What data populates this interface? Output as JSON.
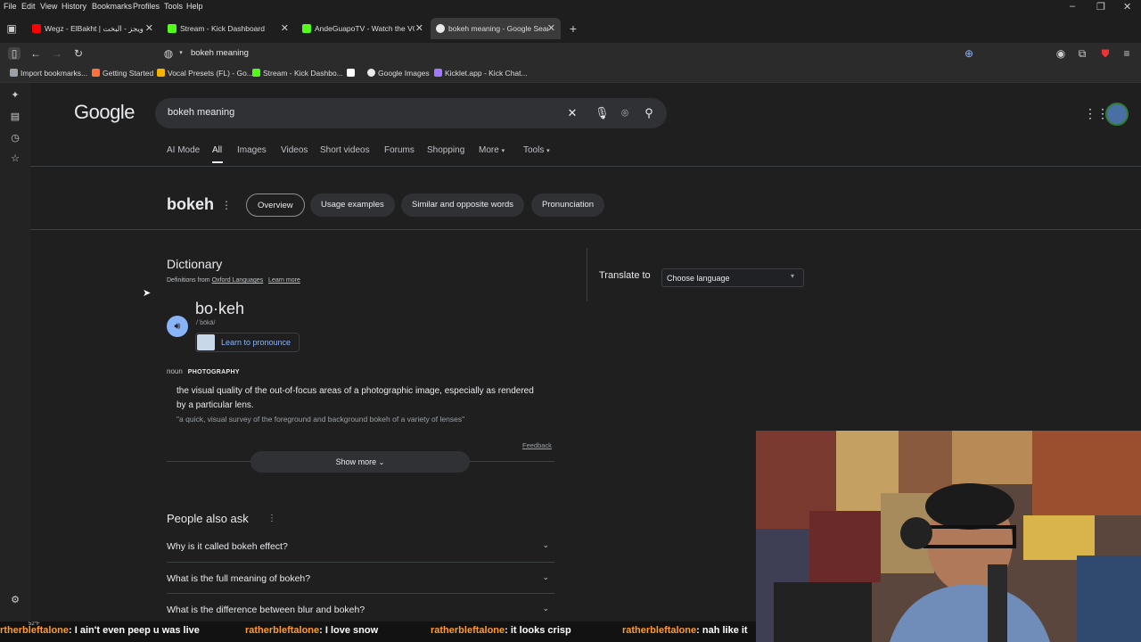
{
  "menubar": {
    "items": [
      "File",
      "Edit",
      "View",
      "History",
      "Bookmarks",
      "Profiles",
      "Tools",
      "Help"
    ]
  },
  "tabs": [
    {
      "title": "Wegz - ElBakht | ويجز - البخت",
      "favicon_color": "#ff0000"
    },
    {
      "title": "Stream - Kick Dashboard",
      "favicon_color": "#53fc18"
    },
    {
      "title": "AndeGuapoTV - Watch the VOD",
      "favicon_color": "#53fc18"
    },
    {
      "title": "bokeh meaning - Google Search",
      "favicon_color": "#e8eaed"
    }
  ],
  "address": {
    "url": "bokeh meaning"
  },
  "toolbar": {
    "extension_badge": "50"
  },
  "bookmarks": [
    {
      "label": "Import bookmarks...",
      "color": "#9aa0a6"
    },
    {
      "label": "Getting Started",
      "color": "#ff7139"
    },
    {
      "label": "Vocal Presets (FL) - Go...",
      "color": "#f4b400"
    },
    {
      "label": "Stream - Kick Dashbo...",
      "color": "#53fc18"
    },
    {
      "label": "",
      "color": "#ffffff"
    },
    {
      "label": "Google Images",
      "color": "#e8eaed"
    },
    {
      "label": "Kicklet.app - Kick Chat...",
      "color": "#a078ff"
    }
  ],
  "google": {
    "logo": "Google",
    "query": "bokeh meaning",
    "nav_tabs": [
      "AI Mode",
      "All",
      "Images",
      "Videos",
      "Short videos",
      "Forums",
      "Shopping",
      "More",
      "Tools"
    ],
    "active_tab": "All"
  },
  "word": {
    "title": "bokeh",
    "chips": [
      "Overview",
      "Usage examples",
      "Similar and opposite words",
      "Pronunciation"
    ]
  },
  "dictionary": {
    "title": "Dictionary",
    "source_prefix": "Definitions from",
    "source": "Oxford Languages",
    "learn_more": "Learn more",
    "headword": "bo·keh",
    "phonetic": "/ˈbōkā/",
    "learn_pronounce": "Learn to pronounce",
    "pos": "noun",
    "domain": "PHOTOGRAPHY",
    "definition": "the visual quality of the out-of-focus areas of a photographic image, especially as rendered by a particular lens.",
    "example": "\"a quick, visual survey of the foreground and background bokeh of a variety of lenses\"",
    "feedback": "Feedback",
    "show_more": "Show more"
  },
  "translate": {
    "label": "Translate to",
    "select": "Choose language"
  },
  "paa": {
    "title": "People also ask",
    "questions": [
      "Why is it called bokeh effect?",
      "What is the full meaning of bokeh?",
      "What is the difference between blur and bokeh?"
    ]
  },
  "ticker": {
    "segments": [
      {
        "user": "rtherbleftalone",
        "msg": ": I ain't even peep u was live"
      },
      {
        "user": "ratherbleftalone",
        "msg": ": I love snow"
      },
      {
        "user": "ratherbleftalone",
        "msg": ": it looks crisp"
      },
      {
        "user": "ratherbleftalone",
        "msg": ": nah like it"
      }
    ],
    "temp": "52°F"
  }
}
